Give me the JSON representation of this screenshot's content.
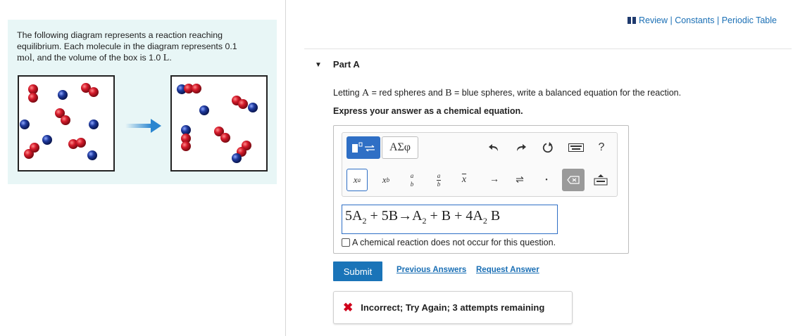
{
  "problem": {
    "text_line1": "The following diagram represents a reaction reaching",
    "text_line2": "equilibrium. Each molecule in the diagram represents 0.1",
    "text_line3_unit_mol": "mol",
    "text_line3_rest": ", and the volume of the box is 1.0 ",
    "text_line3_unit_L": "L",
    "text_line3_end": "."
  },
  "header_links": {
    "review": "Review",
    "constants": "Constants",
    "periodic_table": "Periodic Table",
    "separator": "|"
  },
  "part": {
    "label": "Part A",
    "prompt_pre": "Letting ",
    "prompt_A": "A",
    "prompt_mid1": " = red spheres and ",
    "prompt_B": "B",
    "prompt_mid2": " = blue spheres, write a balanced equation for the reaction.",
    "instruction": "Express your answer as a chemical equation."
  },
  "toolbar": {
    "greek_label": "ΑΣφ",
    "help_label": "?",
    "superscript_x": "x",
    "superscript_a": "a",
    "subscript_x": "x",
    "subscript_b": "b",
    "frac_a": "a",
    "frac_b": "b",
    "vec_x": "x",
    "arrow_right": "→",
    "equilibrium": "⇌",
    "dot": "•"
  },
  "answer": {
    "eq_part1": "5A",
    "eq_sub1": "2",
    "eq_part2": " + 5B→A",
    "eq_sub2": "2",
    "eq_part3": " + B + 4A",
    "eq_sub3": "2",
    "eq_part4": " B",
    "no_reaction_label": "A chemical reaction does not occur for this question.",
    "no_reaction_checked": false
  },
  "actions": {
    "submit": "Submit",
    "previous_answers": "Previous Answers",
    "request_answer": "Request Answer"
  },
  "feedback": {
    "icon": "close-icon",
    "message": "Incorrect; Try Again; 3 attempts remaining"
  },
  "colors": {
    "accent_blue": "#1a74b8",
    "problem_bg": "#e8f6f6",
    "red_sphere": "#d41a2a",
    "blue_sphere": "#1f3a9e",
    "error_red": "#d0021b"
  }
}
